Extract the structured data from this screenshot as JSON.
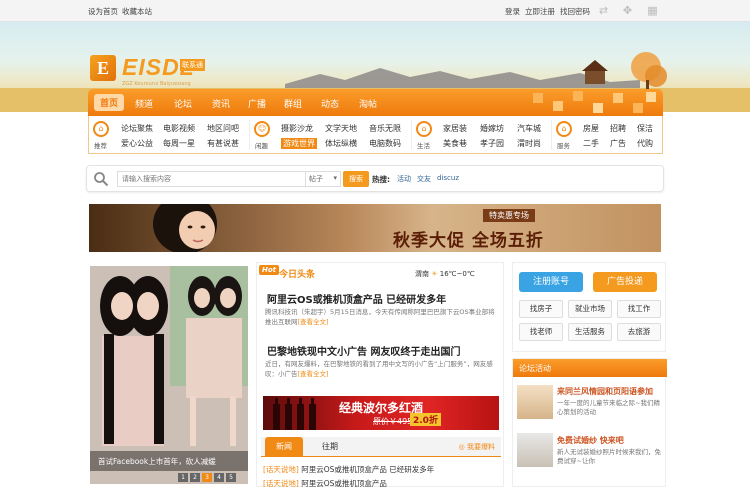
{
  "topbar": {
    "set_home": "设为首页",
    "bookmark": "收藏本站",
    "login": "登录",
    "register": "立即注册",
    "forgot": "找回密码"
  },
  "logo": {
    "mark": "E",
    "text": "EISDL",
    "tag": "联系通",
    "sub": "ZGZ Kourourui Baiyuexiang"
  },
  "nav": {
    "items": [
      "首页",
      "频道",
      "论坛",
      "资讯",
      "广播",
      "群组",
      "动态",
      "淘帖"
    ],
    "active": "首页"
  },
  "categories": {
    "groups": [
      {
        "icon": "⌂",
        "label": "推荐",
        "links": [
          [
            "论坛聚焦",
            "电影视频",
            "地区问吧"
          ],
          [
            "爱心公益",
            "每周一星",
            "有甚说甚"
          ]
        ]
      },
      {
        "icon": "☺",
        "label": "闲趣",
        "links": [
          [
            "摄影沙龙",
            "文学天地",
            "音乐无限"
          ],
          [
            "游戏世界",
            "体坛纵横",
            "电脑数码"
          ]
        ]
      },
      {
        "icon": "⌂",
        "label": "生活",
        "links": [
          [
            "家居装",
            "婚嫁坊",
            "汽车城"
          ],
          [
            "美食巷",
            "孝子园",
            "渭时尚"
          ]
        ]
      },
      {
        "icon": "⌂",
        "label": "服务",
        "links": [
          [
            "房屋",
            "招聘",
            "保洁"
          ],
          [
            "二手",
            "广告",
            "代购"
          ]
        ]
      }
    ],
    "highlight": "游戏世界"
  },
  "search": {
    "placeholder": "请输入搜索内容",
    "select": "帖子",
    "button": "搜索",
    "hot_label": "热搜:",
    "hot_keywords": [
      "活动",
      "交友",
      "discuz"
    ]
  },
  "banner": {
    "tag": "特卖惠专场",
    "main": "秋季大促  全场五折"
  },
  "photo": {
    "caption": "首试Facebook上市首年，砍人减缓",
    "dots": [
      "1",
      "2",
      "3",
      "4",
      "5"
    ],
    "active_dot": "3"
  },
  "headlines": {
    "hot": "Hot",
    "title": "今日头条",
    "city": "渭南",
    "temp": "16℃~0℃",
    "items": [
      {
        "title": "阿里云OS或推机顶盒产品 已经研发多年",
        "summary": "腾讯科技讯（朱超宇）5月15日消息，今天有传闻称阿里巴巴旗下云OS事业部将推出互联网",
        "more": "[查看全文]"
      },
      {
        "title": "巴黎地铁现中文小广告 网友叹终于走出国门",
        "summary": "近日，有网友爆料，在巴黎地铁的看到了用中文写的小广告“上门服务”，网友感叹：小广告",
        "more": "[查看全文]"
      }
    ],
    "wine": {
      "title": "经典波尔多红酒",
      "old_price": "原价￥495",
      "new_price": "2.0折"
    },
    "tabs": [
      "新闻",
      "往期"
    ],
    "tab_right": "我要爆料",
    "lines": [
      {
        "tag": "[话天说地]",
        "text": "阿里云OS或推机顶盒产品 已经研发多年"
      },
      {
        "tag": "[话天说地]",
        "text": "阿里云OS或推机顶盒产品"
      }
    ]
  },
  "right_panel": {
    "register": "注册账号",
    "ad": "广告投递",
    "links": [
      "找房子",
      "就业市场",
      "找工作",
      "找老师",
      "生活服务",
      "去旅游"
    ]
  },
  "forum": {
    "title": "论坛活动",
    "items": [
      {
        "title": "来同兰风情园和页阳语参加",
        "desc": "一年一度的儿童节来临之际~我们精心策划的活动"
      },
      {
        "title": "免费试婚纱 快来吧",
        "desc": "新人无试装婚纱照片时候来我们，免费试穿~让你"
      }
    ]
  },
  "colors": {
    "accent": "#f08a14",
    "nav_top": "#fb9d2b",
    "register_btn": "#3aa3e3",
    "ad_btn": "#f39a1f"
  }
}
